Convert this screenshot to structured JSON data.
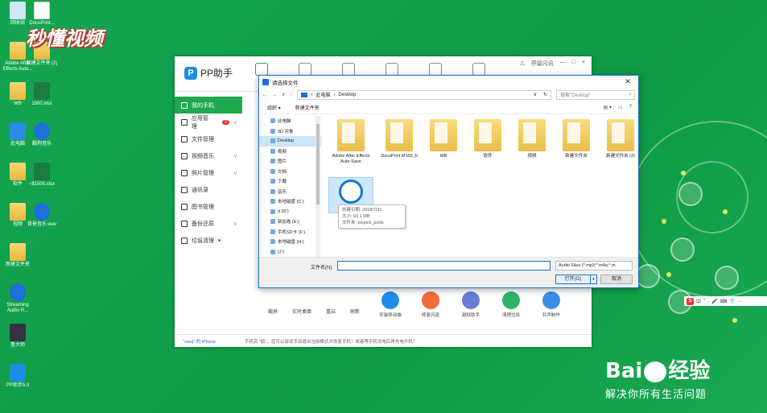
{
  "watermark": {
    "top_text": "秒懂视频",
    "baidu_text": "Bai",
    "baidu_suffix": "经验",
    "slogan": "解决你所有生活问题"
  },
  "desktop_icons": [
    {
      "label": "回收站",
      "kind": "bin"
    },
    {
      "label": "DocuPrint...",
      "kind": "file"
    },
    {
      "label": "Adobe After Effects Auto...",
      "kind": "folder"
    },
    {
      "label": "新建文件夹 (2)",
      "kind": "folder"
    },
    {
      "label": "WB",
      "kind": "folder"
    },
    {
      "label": "1500.xlsx",
      "kind": "excel"
    },
    {
      "label": "此电脑",
      "kind": "pc"
    },
    {
      "label": "酷狗音乐",
      "kind": "blue"
    },
    {
      "label": "软件",
      "kind": "folder"
    },
    {
      "label": "~$1500.xlsx",
      "kind": "excel"
    },
    {
      "label": "视频",
      "kind": "folder"
    },
    {
      "label": "背景音乐.wav",
      "kind": "blue"
    },
    {
      "label": "新建文件夹",
      "kind": "folder"
    },
    {
      "label": "Streaming Audio R...",
      "kind": "blue"
    },
    {
      "label": "鲁大师",
      "kind": "dark"
    },
    {
      "label": "PP助手5.0",
      "kind": "pp"
    }
  ],
  "pp": {
    "logo": "PP助手",
    "window_controls": [
      "△",
      "停留闪讯",
      "—",
      "□",
      "×"
    ],
    "sidebar": [
      {
        "label": "我的手机",
        "active": true
      },
      {
        "label": "应用管理",
        "badge": "2",
        "chev": "∨"
      },
      {
        "label": "文件管理"
      },
      {
        "label": "视频音乐",
        "chev": "∨"
      },
      {
        "label": "照片管理",
        "chev": "∨"
      },
      {
        "label": "通讯录"
      },
      {
        "label": "图书管理"
      },
      {
        "label": "备份还原",
        "chev": "∨"
      },
      {
        "label": "垃圾清理",
        "reddot": true
      }
    ],
    "tools": [
      "截屏",
      "实时桌面",
      "重启",
      "刷新"
    ],
    "apps": [
      {
        "label": "安装移动端",
        "color": "#1e8ce6"
      },
      {
        "label": "修复闪退",
        "color": "#f26b3a"
      },
      {
        "label": "越狱助手",
        "color": "#6b7bd6"
      },
      {
        "label": "清理垃圾",
        "color": "#2fb36a"
      },
      {
        "label": "铃声制作",
        "color": "#3a8ee6"
      }
    ],
    "footer": {
      "device": "\"xiaoj\" 的 iPhone",
      "message": "手机突 \"鹤\"，您可以尝试手动退出当前模式并恢复手机！或者等手机没电后再充电开机！"
    }
  },
  "dialog": {
    "title": "请选择文件",
    "breadcrumb": [
      "此电脑",
      "Desktop"
    ],
    "search_placeholder": "搜索\"Desktop\"",
    "cmd": {
      "organize": "组织 ▾",
      "new_folder": "新建文件夹",
      "help": "?"
    },
    "nav": [
      {
        "label": "此电脑"
      },
      {
        "label": "3D 对象"
      },
      {
        "label": "Desktop",
        "selected": true
      },
      {
        "label": "视频"
      },
      {
        "label": "图片"
      },
      {
        "label": "文档"
      },
      {
        "label": "下载"
      },
      {
        "label": "音乐"
      },
      {
        "label": "本地磁盘 (C:)"
      },
      {
        "label": "d (D:)"
      },
      {
        "label": "新加卷 (E:)"
      },
      {
        "label": "手机SD卡 (F:)"
      },
      {
        "label": "本地磁盘 (H:)"
      },
      {
        "label": " (J:)"
      }
    ],
    "files": [
      {
        "label": "Adobe After Effects Auto-Save"
      },
      {
        "label": "DocuPrint M105_b"
      },
      {
        "label": "WB"
      },
      {
        "label": "软件"
      },
      {
        "label": "视频"
      },
      {
        "label": "新建文件夹"
      },
      {
        "label": "新建文件夹 (2)"
      },
      {
        "label": "背景音乐.wav",
        "audio": true,
        "selected": true
      }
    ],
    "tooltip": {
      "created": "创建日期: 2018/7/31",
      "size": "大小: 93.1 MB",
      "folder": "文件夹: picpick_ports"
    },
    "filename_label": "文件名(N):",
    "filename_value": "",
    "filetype": "Audio Files (*.mp3;*.m4a;*.m",
    "open_btn": "打开(O)",
    "cancel_btn": "取消"
  },
  "ime": {
    "s": "S",
    "items": [
      "中",
      "°",
      ",",
      "🎤",
      "⌨",
      "👕",
      "⋯"
    ]
  }
}
